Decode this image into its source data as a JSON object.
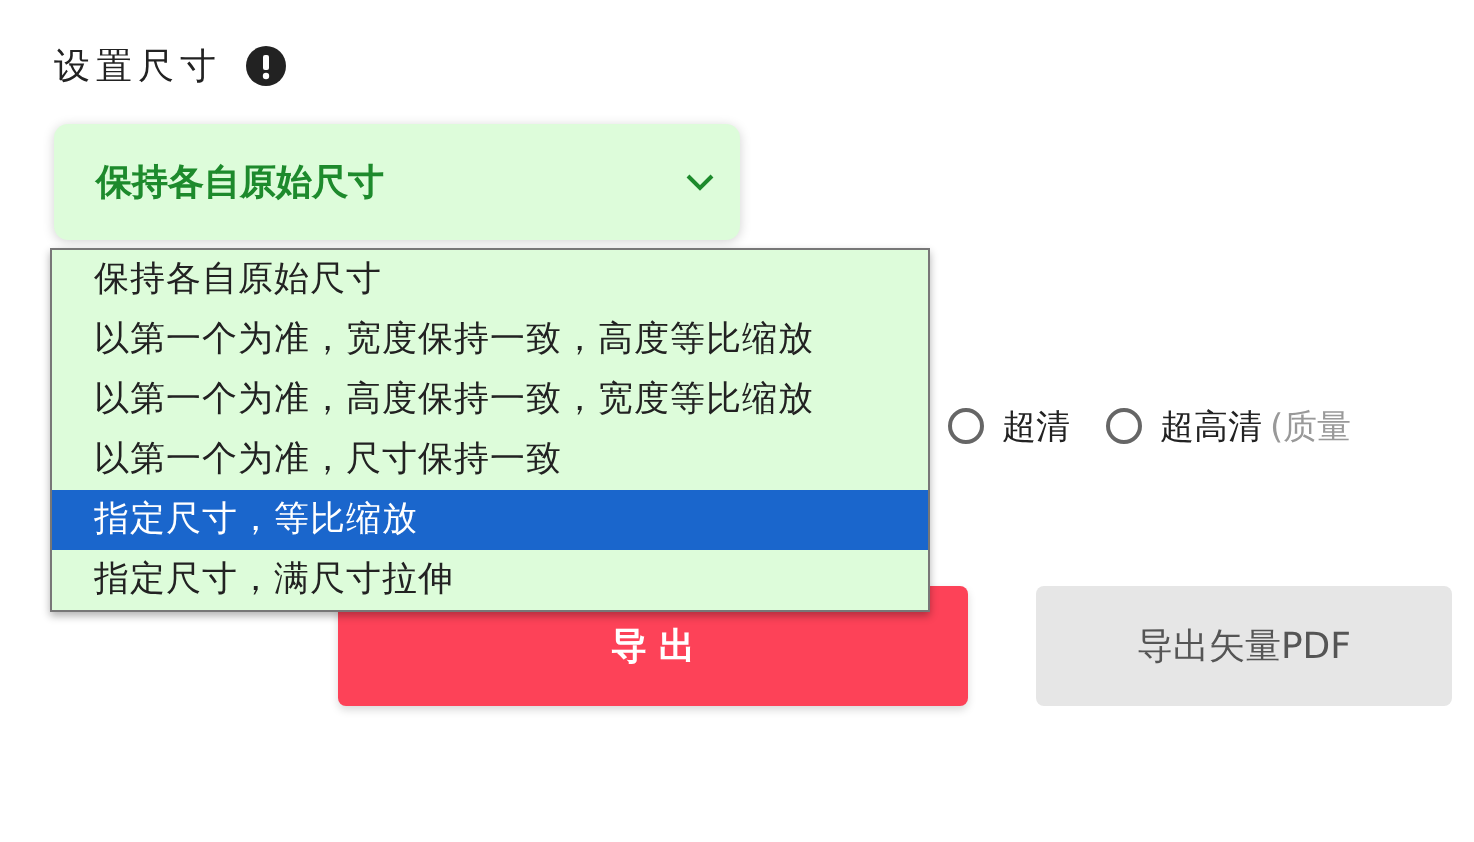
{
  "size_setting": {
    "label": "设置尺寸",
    "select": {
      "value": "保持各自原始尺寸",
      "expanded": true
    },
    "options": [
      {
        "label": "保持各自原始尺寸",
        "selected": false
      },
      {
        "label": "以第一个为准，宽度保持一致，高度等比缩放",
        "selected": false
      },
      {
        "label": "以第一个为准，高度保持一致，宽度等比缩放",
        "selected": false
      },
      {
        "label": "以第一个为准，尺寸保持一致",
        "selected": false
      },
      {
        "label": "指定尺寸，等比缩放",
        "selected": true
      },
      {
        "label": "指定尺寸，满尺寸拉伸",
        "selected": false
      }
    ]
  },
  "quality": [
    {
      "label": "超清",
      "selected": false
    },
    {
      "label": "超高清",
      "note": "(质量",
      "selected": false
    }
  ],
  "buttons": [
    {
      "label": "导 出",
      "kind": "primary"
    },
    {
      "label": "导出矢量PDF",
      "kind": "secondary"
    }
  ]
}
